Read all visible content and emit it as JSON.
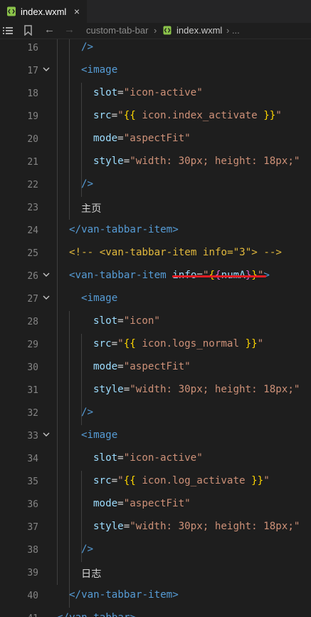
{
  "tab": {
    "filename": "index.wxml",
    "close": "×"
  },
  "breadcrumb": {
    "back": "←",
    "forward": "→",
    "folder": "custom-tab-bar",
    "sep": "›",
    "file": "index.wxml",
    "more": "›  ..."
  },
  "lines": [
    {
      "n": "16",
      "fold": false,
      "indent": 2,
      "segs": [
        [
          "tg",
          "/>"
        ]
      ]
    },
    {
      "n": "17",
      "fold": true,
      "indent": 2,
      "segs": [
        [
          "tg",
          "<image"
        ]
      ]
    },
    {
      "n": "18",
      "fold": false,
      "indent": 3,
      "segs": [
        [
          "at",
          "slot"
        ],
        [
          "eq",
          "="
        ],
        [
          "st",
          "\"icon-active\""
        ]
      ]
    },
    {
      "n": "19",
      "fold": false,
      "indent": 3,
      "segs": [
        [
          "at",
          "src"
        ],
        [
          "eq",
          "="
        ],
        [
          "st",
          "\""
        ],
        [
          "br",
          "{{"
        ],
        [
          "st",
          " icon.index_activate "
        ],
        [
          "br",
          "}}"
        ],
        [
          "st",
          "\""
        ]
      ]
    },
    {
      "n": "20",
      "fold": false,
      "indent": 3,
      "segs": [
        [
          "at",
          "mode"
        ],
        [
          "eq",
          "="
        ],
        [
          "st",
          "\"aspectFit\""
        ]
      ]
    },
    {
      "n": "21",
      "fold": false,
      "indent": 3,
      "segs": [
        [
          "at",
          "style"
        ],
        [
          "eq",
          "="
        ],
        [
          "st",
          "\"width: 30px; height: 18px;\""
        ]
      ]
    },
    {
      "n": "22",
      "fold": false,
      "indent": 2,
      "segs": [
        [
          "tg",
          "/>"
        ]
      ]
    },
    {
      "n": "23",
      "fold": false,
      "indent": 2,
      "segs": [
        [
          "tx",
          "主页"
        ]
      ]
    },
    {
      "n": "24",
      "fold": false,
      "indent": 1,
      "segs": [
        [
          "tg",
          "</van-tabbar-item>"
        ]
      ]
    },
    {
      "n": "25",
      "fold": false,
      "indent": 1,
      "segs": [
        [
          "cm",
          "<!-- <van-tabbar-item info=\"3\"> -->"
        ]
      ]
    },
    {
      "n": "26",
      "fold": true,
      "indent": 1,
      "segs": [
        [
          "tg",
          "<van-tabbar-item "
        ],
        [
          "at",
          "info"
        ],
        [
          "eq",
          "="
        ],
        [
          "st",
          "\""
        ],
        [
          "br",
          "{"
        ],
        [
          "bp",
          "{"
        ],
        [
          "at",
          "numA"
        ],
        [
          "bp",
          "}"
        ],
        [
          "br",
          "}"
        ],
        [
          "st",
          "\""
        ],
        [
          "tg",
          ">"
        ]
      ]
    },
    {
      "n": "27",
      "fold": true,
      "indent": 2,
      "segs": [
        [
          "tg",
          "<image"
        ]
      ]
    },
    {
      "n": "28",
      "fold": false,
      "indent": 3,
      "segs": [
        [
          "at",
          "slot"
        ],
        [
          "eq",
          "="
        ],
        [
          "st",
          "\"icon\""
        ]
      ]
    },
    {
      "n": "29",
      "fold": false,
      "indent": 3,
      "segs": [
        [
          "at",
          "src"
        ],
        [
          "eq",
          "="
        ],
        [
          "st",
          "\""
        ],
        [
          "br",
          "{{"
        ],
        [
          "st",
          " icon.logs_normal "
        ],
        [
          "br",
          "}}"
        ],
        [
          "st",
          "\""
        ]
      ]
    },
    {
      "n": "30",
      "fold": false,
      "indent": 3,
      "segs": [
        [
          "at",
          "mode"
        ],
        [
          "eq",
          "="
        ],
        [
          "st",
          "\"aspectFit\""
        ]
      ]
    },
    {
      "n": "31",
      "fold": false,
      "indent": 3,
      "segs": [
        [
          "at",
          "style"
        ],
        [
          "eq",
          "="
        ],
        [
          "st",
          "\"width: 30px; height: 18px;\""
        ]
      ]
    },
    {
      "n": "32",
      "fold": false,
      "indent": 2,
      "segs": [
        [
          "tg",
          "/>"
        ]
      ]
    },
    {
      "n": "33",
      "fold": true,
      "indent": 2,
      "segs": [
        [
          "tg",
          "<image"
        ]
      ]
    },
    {
      "n": "34",
      "fold": false,
      "indent": 3,
      "segs": [
        [
          "at",
          "slot"
        ],
        [
          "eq",
          "="
        ],
        [
          "st",
          "\"icon-active\""
        ]
      ]
    },
    {
      "n": "35",
      "fold": false,
      "indent": 3,
      "segs": [
        [
          "at",
          "src"
        ],
        [
          "eq",
          "="
        ],
        [
          "st",
          "\""
        ],
        [
          "br",
          "{{"
        ],
        [
          "st",
          " icon.log_activate "
        ],
        [
          "br",
          "}}"
        ],
        [
          "st",
          "\""
        ]
      ]
    },
    {
      "n": "36",
      "fold": false,
      "indent": 3,
      "segs": [
        [
          "at",
          "mode"
        ],
        [
          "eq",
          "="
        ],
        [
          "st",
          "\"aspectFit\""
        ]
      ]
    },
    {
      "n": "37",
      "fold": false,
      "indent": 3,
      "segs": [
        [
          "at",
          "style"
        ],
        [
          "eq",
          "="
        ],
        [
          "st",
          "\"width: 30px; height: 18px;\""
        ]
      ]
    },
    {
      "n": "38",
      "fold": false,
      "indent": 2,
      "segs": [
        [
          "tg",
          "/>"
        ]
      ]
    },
    {
      "n": "39",
      "fold": false,
      "indent": 2,
      "segs": [
        [
          "tx",
          "日志"
        ]
      ]
    },
    {
      "n": "40",
      "fold": false,
      "indent": 1,
      "segs": [
        [
          "tg",
          "</van-tabbar-item>"
        ]
      ]
    },
    {
      "n": "41",
      "fold": false,
      "indent": 0,
      "segs": [
        [
          "tg",
          "</van-tabbar>"
        ]
      ]
    }
  ],
  "colors": {
    "tag": "#569cd6",
    "attr": "#9cdcfe",
    "string": "#ce9178",
    "brace": "#ffd700",
    "brace_inner": "#da70d6",
    "comment": "#e2b93d",
    "underline": "#e51c23"
  }
}
